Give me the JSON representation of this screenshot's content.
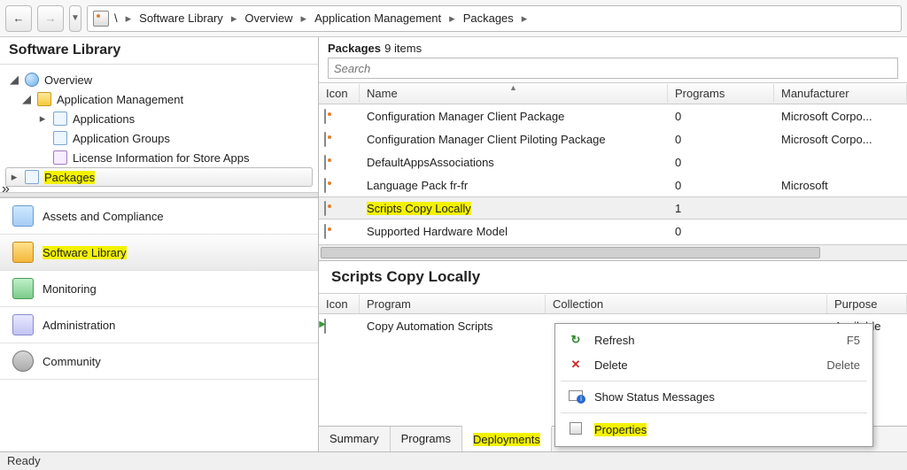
{
  "breadcrumb": {
    "root": "\\",
    "items": [
      "Software Library",
      "Overview",
      "Application Management",
      "Packages"
    ]
  },
  "left": {
    "title": "Software Library",
    "tree": {
      "overview": "Overview",
      "app_mgmt": "Application Management",
      "applications": "Applications",
      "app_groups": "Application Groups",
      "license_info": "License Information for Store Apps",
      "packages": "Packages"
    },
    "wunderbar": {
      "assets": "Assets and Compliance",
      "swlib": "Software Library",
      "monitoring": "Monitoring",
      "admin": "Administration",
      "community": "Community"
    }
  },
  "packages": {
    "title": "Packages",
    "count_label": "9 items",
    "search_placeholder": "Search",
    "columns": {
      "icon": "Icon",
      "name": "Name",
      "programs": "Programs",
      "manufacturer": "Manufacturer"
    },
    "rows": [
      {
        "name": "Configuration Manager Client Package",
        "programs": "0",
        "manufacturer": "Microsoft Corpo..."
      },
      {
        "name": "Configuration Manager Client Piloting Package",
        "programs": "0",
        "manufacturer": "Microsoft Corpo..."
      },
      {
        "name": "DefaultAppsAssociations",
        "programs": "0",
        "manufacturer": ""
      },
      {
        "name": "Language Pack fr-fr",
        "programs": "0",
        "manufacturer": "Microsoft"
      },
      {
        "name": "Scripts Copy Locally",
        "programs": "1",
        "manufacturer": ""
      },
      {
        "name": "Supported Hardware Model",
        "programs": "0",
        "manufacturer": ""
      }
    ]
  },
  "detail": {
    "title": "Scripts Copy Locally",
    "columns": {
      "icon": "Icon",
      "program": "Program",
      "collection": "Collection",
      "purpose": "Purpose"
    },
    "row": {
      "program": "Copy Automation Scripts",
      "collection": "",
      "purpose": "Available"
    },
    "tabs": {
      "summary": "Summary",
      "programs": "Programs",
      "deployments": "Deployments"
    }
  },
  "context_menu": {
    "refresh": {
      "label": "Refresh",
      "shortcut": "F5"
    },
    "delete": {
      "label": "Delete",
      "shortcut": "Delete"
    },
    "status": {
      "label": "Show Status Messages"
    },
    "properties": {
      "label": "Properties"
    }
  },
  "status": "Ready"
}
